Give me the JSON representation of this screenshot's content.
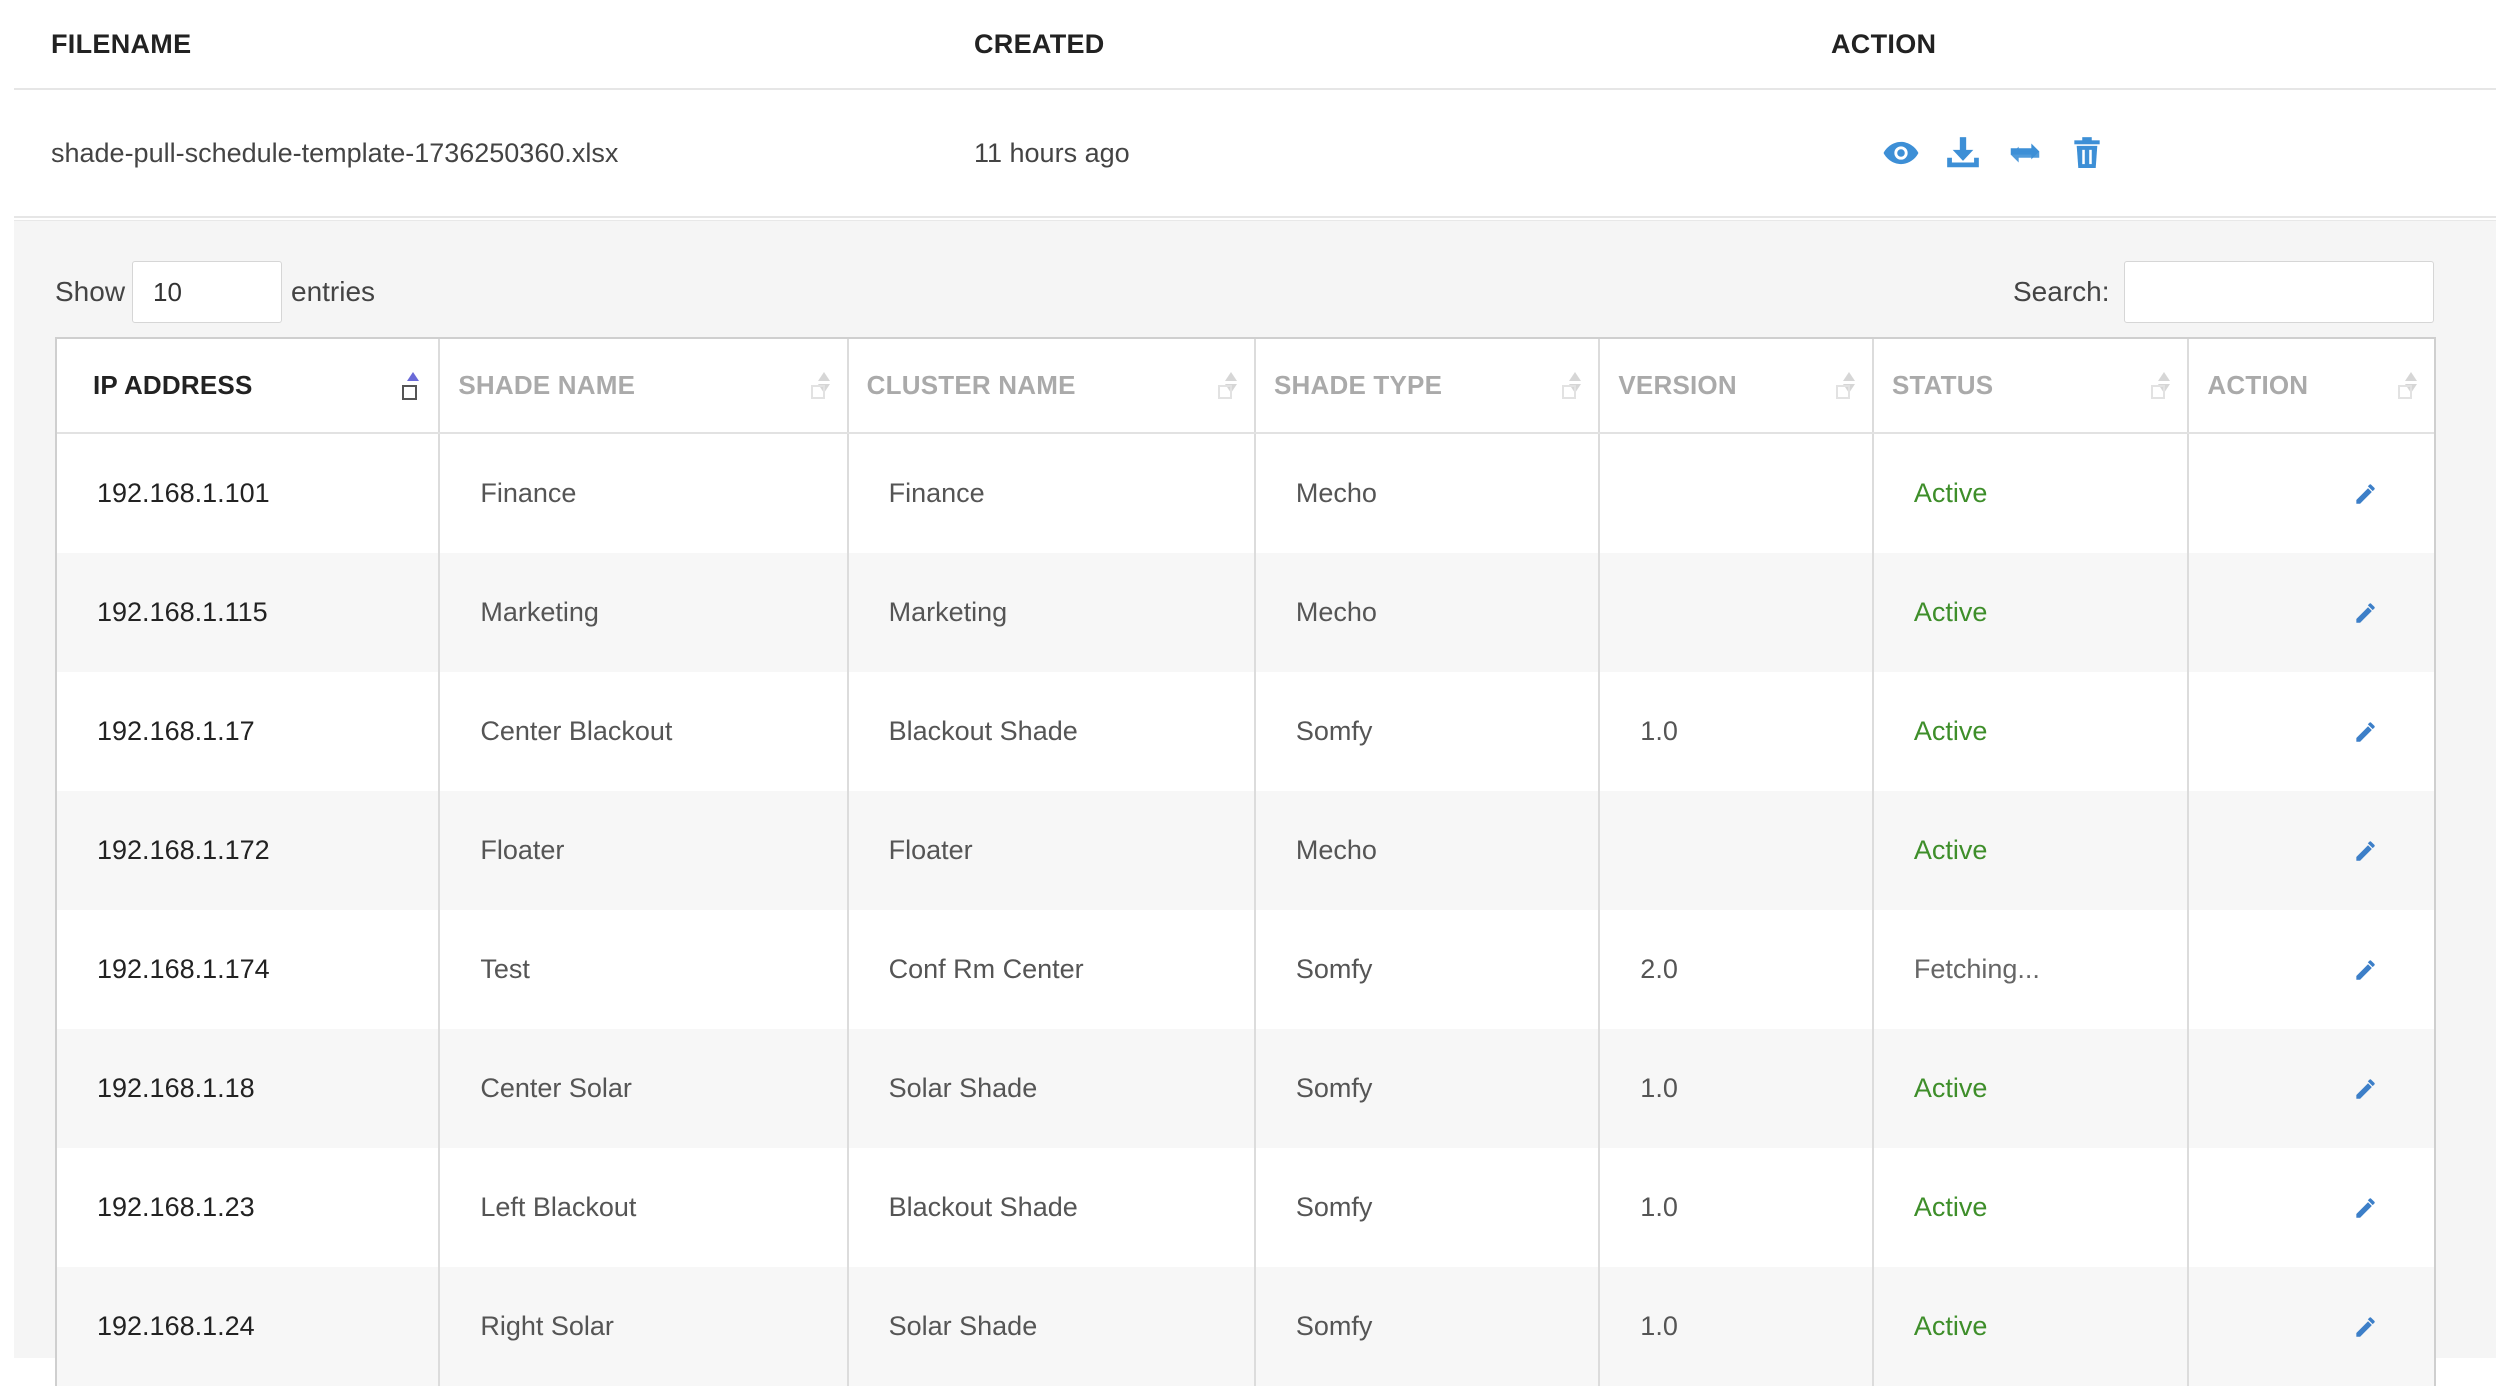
{
  "files_table": {
    "columns": {
      "filename": "FILENAME",
      "created": "CREATED",
      "action": "ACTION"
    },
    "row": {
      "filename": "shade-pull-schedule-template-1736250360.xlsx",
      "created": "11 hours ago",
      "actions": [
        "eye-icon",
        "download-icon",
        "refresh-icon",
        "trash-icon"
      ]
    }
  },
  "controls": {
    "show_label": "Show",
    "entries_value": "10",
    "entries_label": "entries",
    "search_label": "Search:",
    "search_value": ""
  },
  "grid": {
    "headers": [
      "IP ADDRESS",
      "SHADE NAME",
      "CLUSTER NAME",
      "SHADE TYPE",
      "VERSION",
      "STATUS",
      "ACTION"
    ],
    "sorted_column": "IP ADDRESS",
    "rows": [
      {
        "ip": "192.168.1.101",
        "shade_name": "Finance",
        "cluster_name": "Finance",
        "shade_type": "Mecho",
        "version": "",
        "status": "Active"
      },
      {
        "ip": "192.168.1.115",
        "shade_name": "Marketing",
        "cluster_name": "Marketing",
        "shade_type": "Mecho",
        "version": "",
        "status": "Active"
      },
      {
        "ip": "192.168.1.17",
        "shade_name": "Center Blackout",
        "cluster_name": "Blackout Shade",
        "shade_type": "Somfy",
        "version": "1.0",
        "status": "Active"
      },
      {
        "ip": "192.168.1.172",
        "shade_name": "Floater",
        "cluster_name": "Floater",
        "shade_type": "Mecho",
        "version": "",
        "status": "Active"
      },
      {
        "ip": "192.168.1.174",
        "shade_name": "Test",
        "cluster_name": "Conf Rm Center",
        "shade_type": "Somfy",
        "version": "2.0",
        "status": "Fetching..."
      },
      {
        "ip": "192.168.1.18",
        "shade_name": "Center Solar",
        "cluster_name": "Solar Shade",
        "shade_type": "Somfy",
        "version": "1.0",
        "status": "Active"
      },
      {
        "ip": "192.168.1.23",
        "shade_name": "Left Blackout",
        "cluster_name": "Blackout Shade",
        "shade_type": "Somfy",
        "version": "1.0",
        "status": "Active"
      },
      {
        "ip": "192.168.1.24",
        "shade_name": "Right Solar",
        "cluster_name": "Solar Shade",
        "shade_type": "Somfy",
        "version": "1.0",
        "status": "Active"
      }
    ]
  },
  "colors": {
    "icon_blue": "#3d8fd6",
    "status_active": "#3e8e2a",
    "sort_active": "#6a6ad8"
  }
}
